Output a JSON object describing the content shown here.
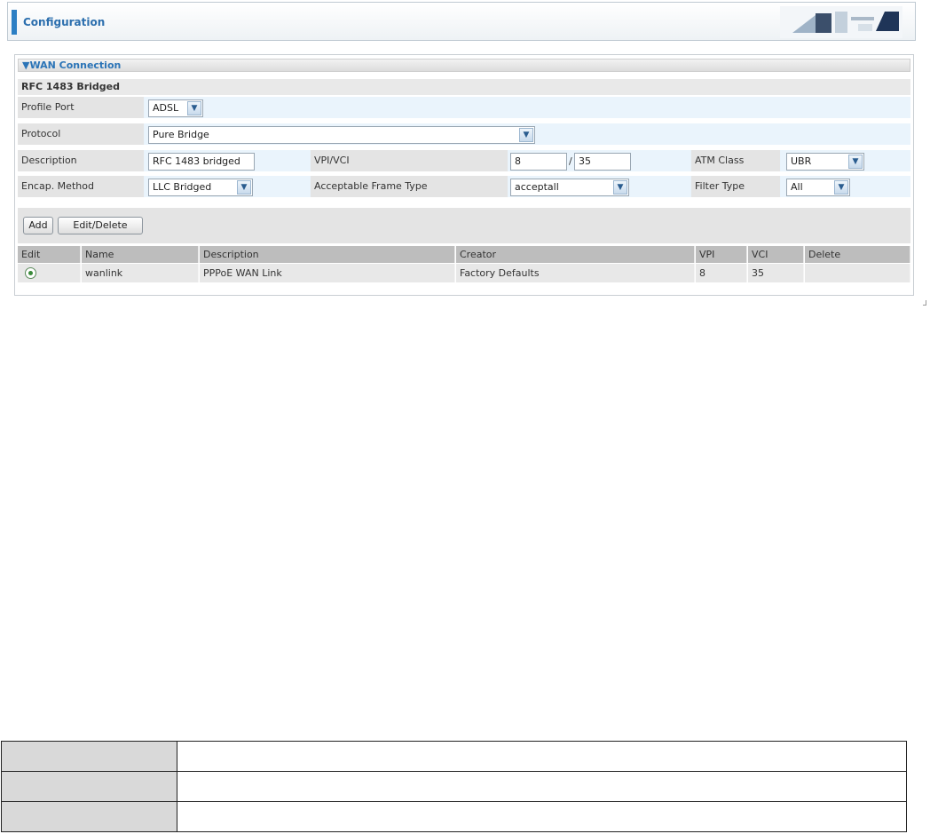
{
  "header": {
    "title": "Configuration"
  },
  "section": {
    "title": "▼WAN Connection",
    "subtitle": "RFC 1483 Bridged"
  },
  "form": {
    "profile_port": {
      "label": "Profile Port",
      "value": "ADSL"
    },
    "protocol": {
      "label": "Protocol",
      "value": "Pure Bridge"
    },
    "description": {
      "label": "Description",
      "value": "RFC 1483 bridged"
    },
    "vpi_vci": {
      "label": "VPI/VCI",
      "vpi": "8",
      "separator": "/",
      "vci": "35"
    },
    "atm_class": {
      "label": "ATM Class",
      "value": "UBR"
    },
    "encap_method": {
      "label": "Encap. Method",
      "value": "LLC Bridged"
    },
    "frame_type": {
      "label": "Acceptable Frame Type",
      "value": "acceptall"
    },
    "filter_type": {
      "label": "Filter Type",
      "value": "All"
    }
  },
  "buttons": {
    "add": "Add",
    "edit_delete": "Edit/Delete"
  },
  "table": {
    "headers": [
      "Edit",
      "Name",
      "Description",
      "Creator",
      "VPI",
      "VCI",
      "Delete"
    ],
    "rows": [
      {
        "name": "wanlink",
        "description": "PPPoE WAN Link",
        "creator": "Factory Defaults",
        "vpi": "8",
        "vci": "35",
        "delete": ""
      }
    ]
  },
  "icons": {
    "dropdown": "chevron-down-icon",
    "edit_radio": "radio-selected-icon"
  },
  "colors": {
    "accent": "#2c7fc4",
    "title": "#2c6fae",
    "row_bg": "#e9f3fb",
    "label_bg": "#e4e4e4",
    "header_cell_bg": "#bdbdbd"
  }
}
